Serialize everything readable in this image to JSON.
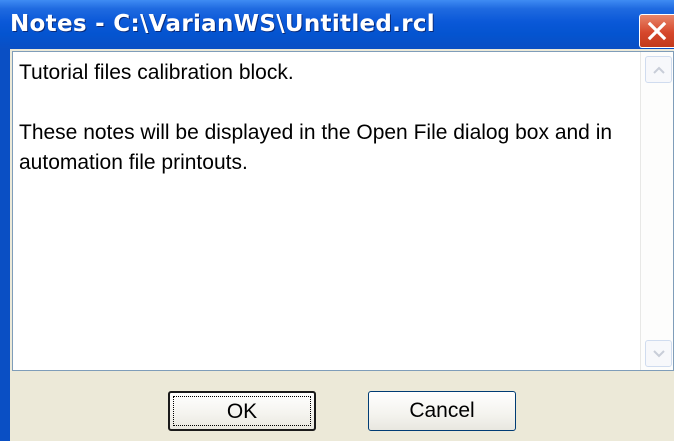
{
  "window": {
    "title": "Notes - C:\\VarianWS\\Untitled.rcl"
  },
  "notes": {
    "line1": "Tutorial files calibration block.",
    "line2": "These notes will be displayed in the Open File dialog box and in automation file printouts."
  },
  "buttons": {
    "ok_label": "OK",
    "cancel_label": "Cancel"
  },
  "icons": {
    "close": "close-icon",
    "scroll_up": "scroll-up-arrow-icon",
    "scroll_down": "scroll-down-arrow-icon"
  },
  "colors": {
    "titlebar": "#0454d0",
    "close_button": "#d6472b",
    "dialog_background": "#ece9d8"
  }
}
